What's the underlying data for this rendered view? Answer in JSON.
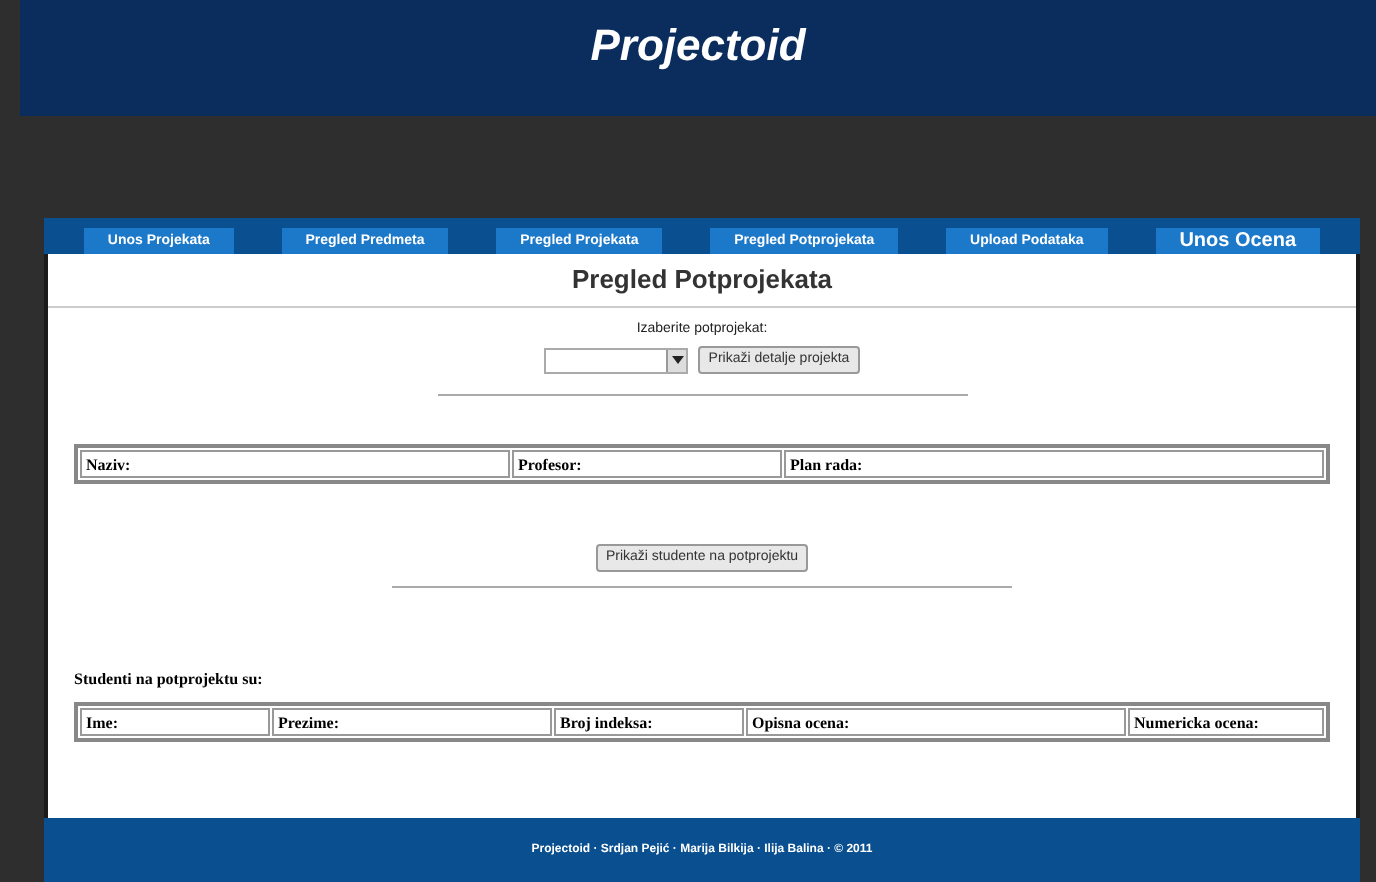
{
  "header": {
    "title": "Projectoid"
  },
  "nav": [
    {
      "label": "Unos Projekata"
    },
    {
      "label": "Pregled Predmeta"
    },
    {
      "label": "Pregled Projekata"
    },
    {
      "label": "Pregled Potprojekata"
    },
    {
      "label": "Upload Podataka"
    },
    {
      "label": "Unos Ocena"
    }
  ],
  "page_title": "Pregled Potprojekata",
  "select_label": "Izaberite potprojekat:",
  "details_button": "Prikaži detalje projekta",
  "details_table": [
    "Naziv:",
    "Profesor:",
    "Plan rada:"
  ],
  "students_button": "Prikaži studente na potprojektu",
  "students_heading": "Studenti na potprojektu su:",
  "students_table": [
    "Ime:",
    "Prezime:",
    "Broj indeksa:",
    "Opisna ocena:",
    "Numericka ocena:"
  ],
  "footer": "Projectoid · Srdjan Pejić · Marija Bilkija · Ilija Balina · © 2011"
}
